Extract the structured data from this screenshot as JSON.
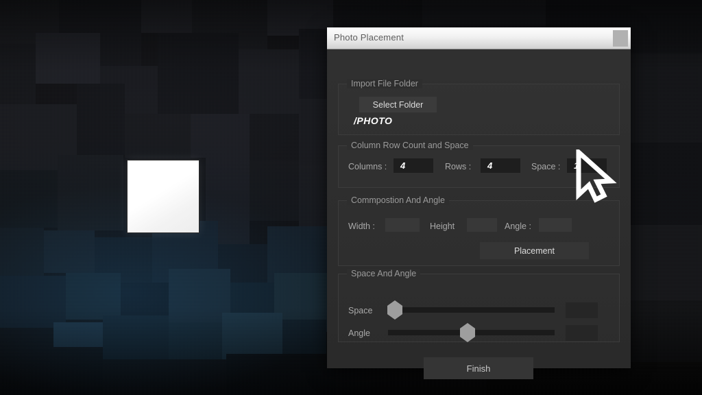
{
  "window": {
    "title": "Photo Placement",
    "close_button_name": "close-button"
  },
  "groups": {
    "import": {
      "title": "Import File Folder",
      "select_folder_label": "Select Folder",
      "folder_path": "/PHOTO"
    },
    "count": {
      "title": "Column Row Count and Space",
      "fields": [
        {
          "label": "Columns :",
          "value": "4"
        },
        {
          "label": "Rows :",
          "value": "4"
        },
        {
          "label": "Space :",
          "value": "1"
        }
      ]
    },
    "composition": {
      "title": "Commpostion And Angle",
      "fields": [
        {
          "label": "Width :",
          "value": ""
        },
        {
          "label": "Height",
          "value": ""
        },
        {
          "label": "Angle :",
          "value": ""
        }
      ],
      "placement_label": "Placement"
    },
    "space_angle": {
      "title": "Space And Angle",
      "sliders": [
        {
          "label": "Space",
          "position_percent": 0,
          "value": ""
        },
        {
          "label": "Angle",
          "position_percent": 44,
          "value": ""
        }
      ]
    }
  },
  "footer": {
    "finish_label": "Finish"
  },
  "canvas": {
    "photo_square_name": "photo-thumbnail"
  },
  "colors": {
    "titlebar_text": "#5d5d5d",
    "dialog_bg": "#2d2d2d",
    "group_border": "#3c3c3c",
    "label_text": "#a9a9a9",
    "input_bg": "#1e1e1e",
    "input_text": "#ffffff",
    "button_bg": "#3b3b3b",
    "slider_handle": "#9e9e9e",
    "cursor": "#ffffff"
  }
}
